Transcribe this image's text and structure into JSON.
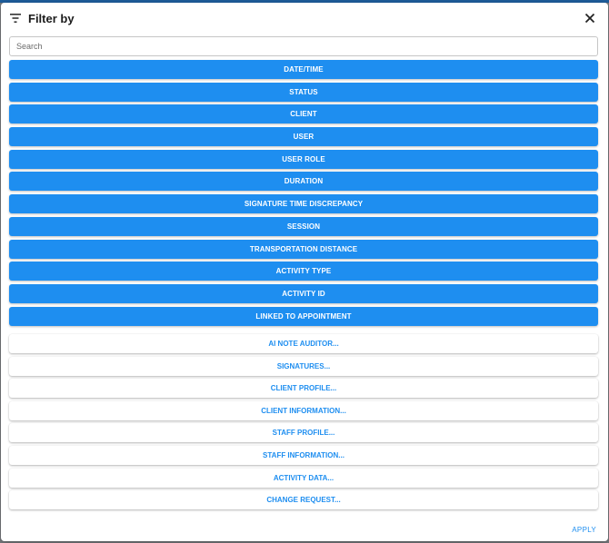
{
  "dialog": {
    "title": "Filter by",
    "icons": {
      "filter": "filter-lines-icon",
      "close": "close-icon"
    }
  },
  "search": {
    "placeholder": "Search",
    "value": ""
  },
  "filters": [
    {
      "label": "DATE/TIME"
    },
    {
      "label": "STATUS"
    },
    {
      "label": "CLIENT"
    },
    {
      "label": "USER"
    },
    {
      "label": "USER ROLE"
    },
    {
      "label": "DURATION"
    },
    {
      "label": "SIGNATURE TIME DISCREPANCY"
    },
    {
      "label": "SESSION"
    },
    {
      "label": "TRANSPORTATION DISTANCE"
    },
    {
      "label": "ACTIVITY TYPE"
    },
    {
      "label": "ACTIVITY ID"
    },
    {
      "label": "LINKED TO APPOINTMENT"
    }
  ],
  "more_filters": [
    {
      "label": "AI NOTE AUDITOR..."
    },
    {
      "label": "SIGNATURES..."
    },
    {
      "label": "CLIENT PROFILE..."
    },
    {
      "label": "CLIENT INFORMATION..."
    },
    {
      "label": "STAFF PROFILE..."
    },
    {
      "label": "STAFF INFORMATION..."
    },
    {
      "label": "ACTIVITY DATA..."
    },
    {
      "label": "CHANGE REQUEST..."
    }
  ],
  "footer": {
    "apply_label": "APPLY"
  },
  "colors": {
    "primary": "#1e8ef0",
    "title_text": "#1c1c1c",
    "backdrop": "#7a7d80"
  }
}
